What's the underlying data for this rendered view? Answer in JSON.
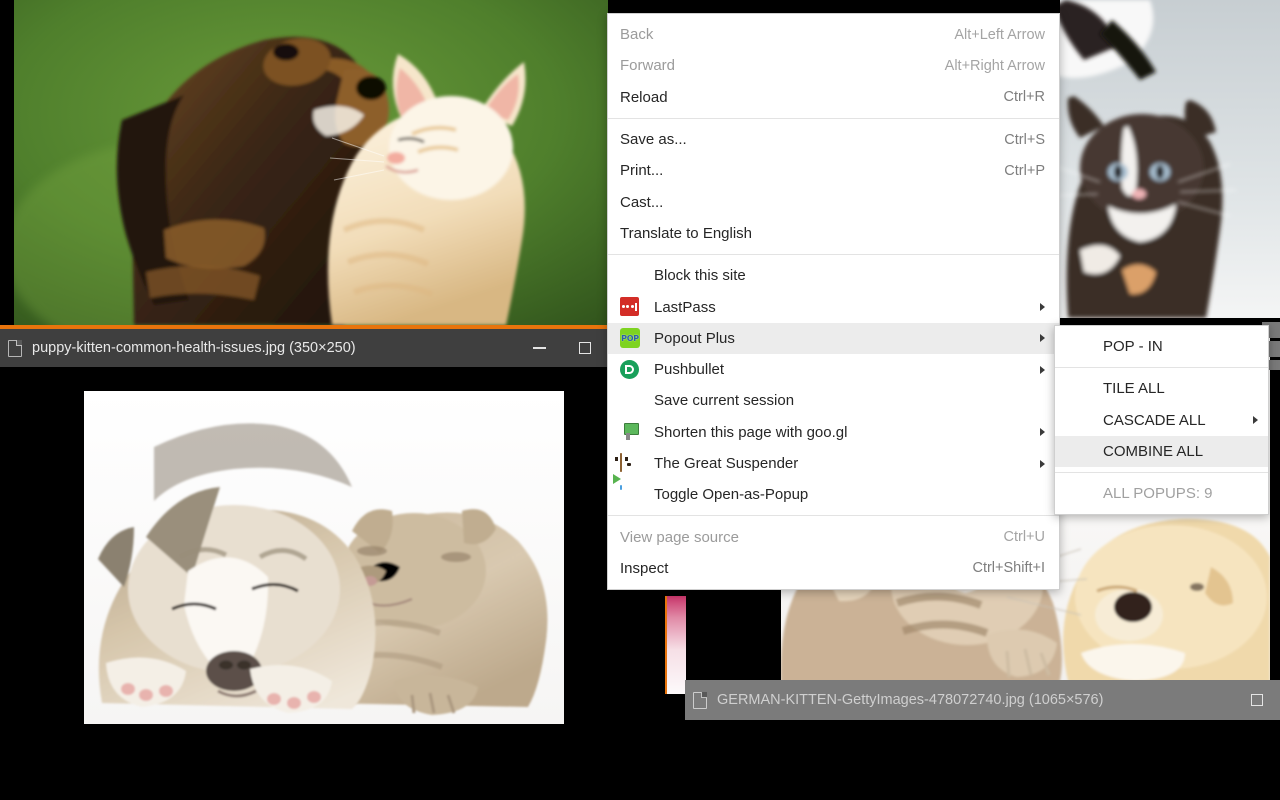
{
  "windows": {
    "front": {
      "title": "puppy-kitten-common-health-issues.jpg (350×250)",
      "minimize_label": "—",
      "maximize_label": "□",
      "titlebar_color": "#3f3f3f",
      "accent_color": "#e8740c"
    },
    "back": {
      "title": "GERMAN-KITTEN-GettyImages-478072740.jpg (1065×576)",
      "titlebar_color": "#7b7b7b"
    }
  },
  "context_menu": {
    "groups": [
      {
        "items": [
          {
            "label": "Back",
            "accel": "Alt+Left Arrow",
            "disabled": true,
            "icon": "",
            "submenu": false
          },
          {
            "label": "Forward",
            "accel": "Alt+Right Arrow",
            "disabled": true,
            "icon": "",
            "submenu": false
          },
          {
            "label": "Reload",
            "accel": "Ctrl+R",
            "disabled": false,
            "icon": "",
            "submenu": false
          }
        ]
      },
      {
        "items": [
          {
            "label": "Save as...",
            "accel": "Ctrl+S",
            "disabled": false,
            "icon": "",
            "submenu": false
          },
          {
            "label": "Print...",
            "accel": "Ctrl+P",
            "disabled": false,
            "icon": "",
            "submenu": false
          },
          {
            "label": "Cast...",
            "accel": "",
            "disabled": false,
            "icon": "",
            "submenu": false
          },
          {
            "label": "Translate to English",
            "accel": "",
            "disabled": false,
            "icon": "",
            "submenu": false
          }
        ]
      },
      {
        "items": [
          {
            "label": "Block this site",
            "accel": "",
            "disabled": false,
            "icon": "shield-icon",
            "submenu": false
          },
          {
            "label": "LastPass",
            "accel": "",
            "disabled": false,
            "icon": "lastpass-icon",
            "submenu": true
          },
          {
            "label": "Popout Plus",
            "accel": "",
            "disabled": false,
            "icon": "popout-plus-icon",
            "submenu": true,
            "selected": true
          },
          {
            "label": "Pushbullet",
            "accel": "",
            "disabled": false,
            "icon": "pushbullet-icon",
            "submenu": true
          },
          {
            "label": "Save current session",
            "accel": "",
            "disabled": false,
            "icon": "save-session-icon",
            "submenu": false
          },
          {
            "label": "Shorten this page with goo.gl",
            "accel": "",
            "disabled": false,
            "icon": "goo-gl-icon",
            "submenu": true
          },
          {
            "label": "The Great Suspender",
            "accel": "",
            "disabled": false,
            "icon": "great-suspender-icon",
            "submenu": true
          },
          {
            "label": "Toggle Open-as-Popup",
            "accel": "",
            "disabled": false,
            "icon": "toggle-popup-icon",
            "submenu": false
          }
        ]
      },
      {
        "items": [
          {
            "label": "View page source",
            "accel": "Ctrl+U",
            "disabled": true,
            "icon": "",
            "submenu": false
          },
          {
            "label": "Inspect",
            "accel": "Ctrl+Shift+I",
            "disabled": false,
            "icon": "",
            "submenu": false
          }
        ]
      }
    ]
  },
  "submenu": {
    "groups": [
      {
        "items": [
          {
            "label": "POP - IN",
            "disabled": false,
            "submenu": false
          }
        ]
      },
      {
        "items": [
          {
            "label": "TILE ALL",
            "disabled": false,
            "submenu": false
          },
          {
            "label": "CASCADE ALL",
            "disabled": false,
            "submenu": true
          },
          {
            "label": "COMBINE ALL",
            "disabled": false,
            "submenu": false,
            "selected": true
          }
        ]
      },
      {
        "items": [
          {
            "label": "ALL POPUPS: 9",
            "disabled": true,
            "submenu": false
          }
        ]
      }
    ]
  }
}
